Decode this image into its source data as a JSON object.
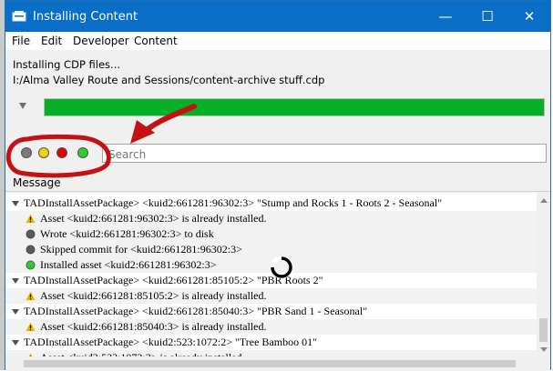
{
  "window": {
    "title": "Installing Content",
    "minimize_glyph": "—",
    "maximize_glyph": "☐",
    "close_glyph": "✕"
  },
  "menu": {
    "items": [
      "File",
      "Edit",
      "Developer",
      "Content"
    ]
  },
  "status": {
    "line1": "Installing CDP files...",
    "line2": "I:/Alma Valley Route and Sessions/content-archive stuff.cdp"
  },
  "progress": {
    "fraction": 1.0,
    "color": "#06b025"
  },
  "filters": [
    {
      "name": "all",
      "color": "#7a7a7a"
    },
    {
      "name": "warnings",
      "color": "#f2d200"
    },
    {
      "name": "errors",
      "color": "#e60000"
    },
    {
      "name": "success",
      "color": "#2ecc2e"
    }
  ],
  "search": {
    "placeholder": "Search",
    "value": ""
  },
  "log": {
    "header": "Message",
    "rows": [
      {
        "type": "group",
        "icon": "expand-icon",
        "text": "TADInstallAssetPackage> <kuid2:661281:96302:3> \"Stump and Rocks 1 - Roots 2 - Seasonal\""
      },
      {
        "type": "item",
        "icon": "warning-icon",
        "text": "Asset <kuid2:661281:96302:3> is already installed."
      },
      {
        "type": "item",
        "icon": "info-dot-icon",
        "text": "Wrote <kuid2:661281:96302:3> to disk"
      },
      {
        "type": "item",
        "icon": "info-dot-icon",
        "text": "Skipped commit for <kuid2:661281:96302:3>"
      },
      {
        "type": "item",
        "icon": "success-dot-icon",
        "text": "Installed asset <kuid2:661281:96302:3>"
      },
      {
        "type": "group",
        "icon": "expand-icon",
        "text": "TADInstallAssetPackage> <kuid2:661281:85105:2> \"PBR Roots 2\""
      },
      {
        "type": "item",
        "icon": "warning-icon",
        "text": "Asset <kuid2:661281:85105:2> is already installed."
      },
      {
        "type": "group",
        "icon": "expand-icon",
        "text": "TADInstallAssetPackage> <kuid2:661281:85040:3> \"PBR Sand 1 - Seasonal\""
      },
      {
        "type": "item",
        "icon": "warning-icon",
        "text": "Asset <kuid2:661281:85040:3> is already installed."
      },
      {
        "type": "group",
        "icon": "expand-icon",
        "text": "TADInstallAssetPackage> <kuid2:523:1072:2> \"Tree Bamboo 01\""
      },
      {
        "type": "item",
        "icon": "warning-icon",
        "text": "Asset <kuid2:523:1072:2> is already installed."
      }
    ]
  },
  "colors": {
    "titlebar": "#0b6ec6",
    "annotation": "#c41212",
    "warning": "#f0b400"
  }
}
